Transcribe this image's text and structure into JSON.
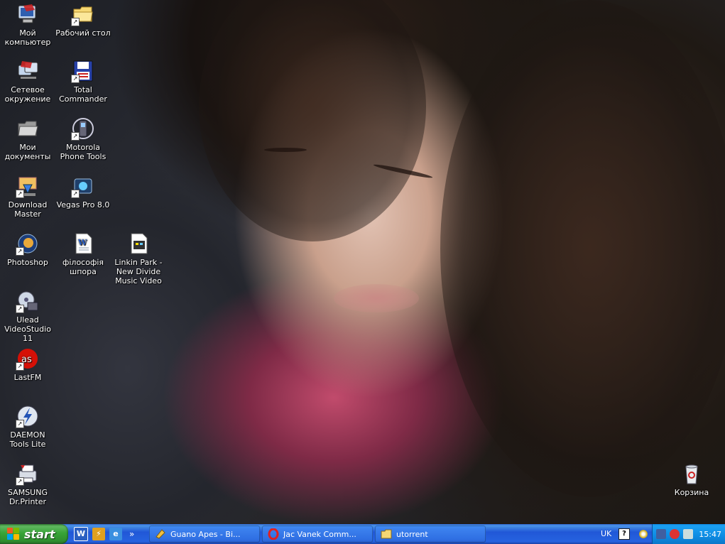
{
  "desktop": {
    "icons": [
      {
        "label": "Мой компьютер",
        "shortcut": false
      },
      {
        "label": "Рабочий стол",
        "shortcut": true
      },
      {
        "label": "Сетевое окружение",
        "shortcut": false
      },
      {
        "label": "Total Commander",
        "shortcut": true
      },
      {
        "label": "Мои документы",
        "shortcut": false
      },
      {
        "label": "Motorola Phone Tools",
        "shortcut": true
      },
      {
        "label": "Download Master",
        "shortcut": true
      },
      {
        "label": "Vegas Pro 8.0",
        "shortcut": true
      },
      {
        "label": "Photoshop",
        "shortcut": true
      },
      {
        "label": "філософія шпора",
        "shortcut": false
      },
      {
        "label": "Linkin Park - New Divide Music Video",
        "shortcut": false
      },
      {
        "label": "Ulead VideoStudio 11",
        "shortcut": true
      },
      {
        "label": "LastFM",
        "shortcut": true
      },
      {
        "label": "DAEMON Tools Lite",
        "shortcut": true
      },
      {
        "label": "SAMSUNG Dr.Printer",
        "shortcut": true
      },
      {
        "label": "Корзина",
        "shortcut": false
      }
    ]
  },
  "taskbar": {
    "start_label": "start",
    "quick_launch": [
      "word-icon",
      "winamp-icon",
      "ie-icon"
    ],
    "quick_more": "»",
    "tasks": [
      {
        "label": "Guano Apes - Bi...",
        "icon": "media-player-icon",
        "active": false
      },
      {
        "label": "Jac Vanek Comm...",
        "icon": "opera-icon",
        "active": false
      },
      {
        "label": "utorrent",
        "icon": "folder-icon",
        "active": false
      }
    ],
    "language": "UK",
    "help_mark": "?",
    "clock": "15:47"
  },
  "colors": {
    "taskbar": "#2663e0",
    "start": "#37a437",
    "tray": "#0d8ce3"
  }
}
